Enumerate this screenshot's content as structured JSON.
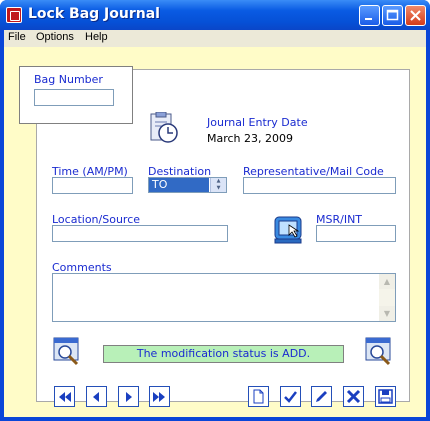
{
  "window": {
    "title": "Lock Bag Journal"
  },
  "menu": {
    "items": [
      "File",
      "Options",
      "Help"
    ]
  },
  "form": {
    "bag_number": {
      "label": "Bag Number",
      "value": ""
    },
    "journal_entry_date": {
      "label": "Journal Entry Date",
      "value": "March 23, 2009"
    },
    "time": {
      "label": "Time (AM/PM)",
      "value": ""
    },
    "destination": {
      "label": "Destination",
      "value": "TO"
    },
    "representative": {
      "label": "Representative/Mail Code",
      "value": ""
    },
    "location": {
      "label": "Location/Source",
      "value": ""
    },
    "msr_int": {
      "label": "MSR/INT",
      "value": ""
    },
    "comments": {
      "label": "Comments",
      "value": ""
    },
    "status": "The modification status is ADD."
  },
  "icons": {
    "date": "clipboard-clock-icon",
    "lookup": "computer-pointer-icon",
    "search_left": "magnifier-window-icon",
    "search_right": "magnifier-window-icon"
  },
  "toolbar": {
    "first": "first-record",
    "prev": "previous-record",
    "next": "next-record",
    "last": "last-record",
    "new": "new-document",
    "confirm": "check",
    "edit": "pencil",
    "delete": "delete",
    "save": "save"
  },
  "colors": {
    "titlebar": "#0a5be3",
    "background": "#fffcc8",
    "label": "#1a2bd0",
    "status_bg": "#b8f0b8",
    "selection": "#316ac5"
  }
}
